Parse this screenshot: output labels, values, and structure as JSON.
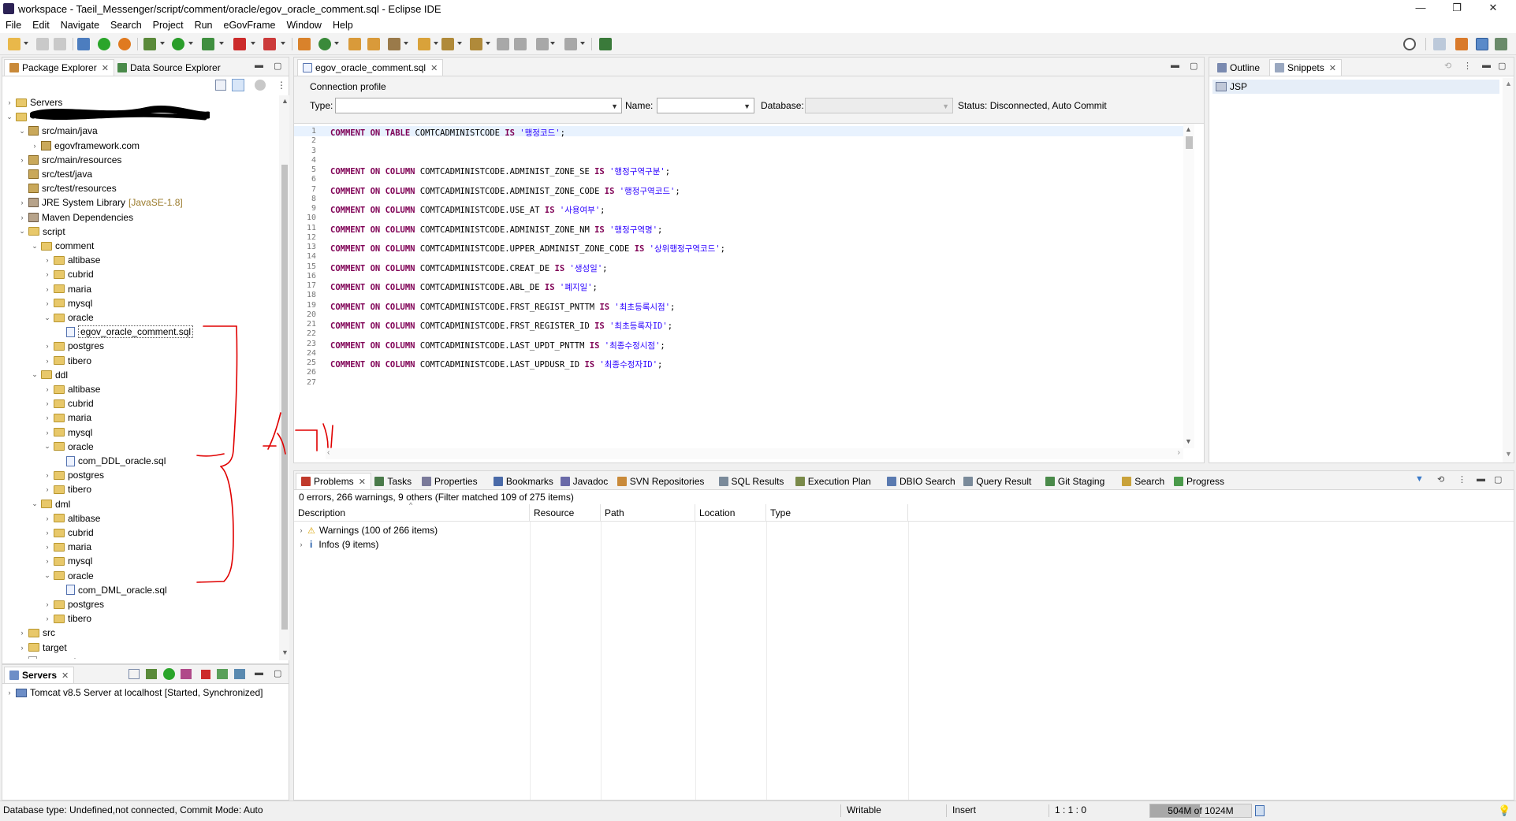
{
  "window": {
    "title": "workspace - Taeil_Messenger/script/comment/oracle/egov_oracle_comment.sql - Eclipse IDE",
    "minimize": "—",
    "maximize": "❐",
    "close": "✕"
  },
  "menu": [
    "File",
    "Edit",
    "Navigate",
    "Search",
    "Project",
    "Run",
    "eGovFrame",
    "Window",
    "Help"
  ],
  "left_panel": {
    "tabs": [
      "Package Explorer",
      "Data Source Explorer"
    ],
    "tree": [
      {
        "label": "Servers",
        "depth": 0,
        "icon": "folder",
        "twisty": "collapsed"
      },
      {
        "label": "",
        "depth": 0,
        "icon": "project",
        "twisty": "expanded",
        "redacted": true
      },
      {
        "label": "src/main/java",
        "depth": 1,
        "icon": "package-folder",
        "twisty": "expanded"
      },
      {
        "label": "egovframework.com",
        "depth": 2,
        "icon": "package",
        "twisty": "collapsed"
      },
      {
        "label": "src/main/resources",
        "depth": 1,
        "icon": "package-folder",
        "twisty": "collapsed"
      },
      {
        "label": "src/test/java",
        "depth": 1,
        "icon": "package-folder",
        "twisty": "none"
      },
      {
        "label": "src/test/resources",
        "depth": 1,
        "icon": "package-folder",
        "twisty": "none"
      },
      {
        "label": "JRE System Library",
        "suffix": "[JavaSE-1.8]",
        "depth": 1,
        "icon": "library",
        "twisty": "collapsed"
      },
      {
        "label": "Maven Dependencies",
        "depth": 1,
        "icon": "library",
        "twisty": "collapsed"
      },
      {
        "label": "script",
        "depth": 1,
        "icon": "folder",
        "twisty": "expanded"
      },
      {
        "label": "comment",
        "depth": 2,
        "icon": "folder",
        "twisty": "expanded"
      },
      {
        "label": "altibase",
        "depth": 3,
        "icon": "folder",
        "twisty": "collapsed"
      },
      {
        "label": "cubrid",
        "depth": 3,
        "icon": "folder",
        "twisty": "collapsed"
      },
      {
        "label": "maria",
        "depth": 3,
        "icon": "folder",
        "twisty": "collapsed"
      },
      {
        "label": "mysql",
        "depth": 3,
        "icon": "folder",
        "twisty": "collapsed"
      },
      {
        "label": "oracle",
        "depth": 3,
        "icon": "folder",
        "twisty": "expanded"
      },
      {
        "label": "egov_oracle_comment.sql",
        "depth": 4,
        "icon": "sql-file",
        "twisty": "none",
        "selected": true
      },
      {
        "label": "postgres",
        "depth": 3,
        "icon": "folder",
        "twisty": "collapsed"
      },
      {
        "label": "tibero",
        "depth": 3,
        "icon": "folder",
        "twisty": "collapsed"
      },
      {
        "label": "ddl",
        "depth": 2,
        "icon": "folder",
        "twisty": "expanded"
      },
      {
        "label": "altibase",
        "depth": 3,
        "icon": "folder",
        "twisty": "collapsed"
      },
      {
        "label": "cubrid",
        "depth": 3,
        "icon": "folder",
        "twisty": "collapsed"
      },
      {
        "label": "maria",
        "depth": 3,
        "icon": "folder",
        "twisty": "collapsed"
      },
      {
        "label": "mysql",
        "depth": 3,
        "icon": "folder",
        "twisty": "collapsed"
      },
      {
        "label": "oracle",
        "depth": 3,
        "icon": "folder",
        "twisty": "expanded"
      },
      {
        "label": "com_DDL_oracle.sql",
        "depth": 4,
        "icon": "sql-file",
        "twisty": "none"
      },
      {
        "label": "postgres",
        "depth": 3,
        "icon": "folder",
        "twisty": "collapsed"
      },
      {
        "label": "tibero",
        "depth": 3,
        "icon": "folder",
        "twisty": "collapsed"
      },
      {
        "label": "dml",
        "depth": 2,
        "icon": "folder",
        "twisty": "expanded"
      },
      {
        "label": "altibase",
        "depth": 3,
        "icon": "folder",
        "twisty": "collapsed"
      },
      {
        "label": "cubrid",
        "depth": 3,
        "icon": "folder",
        "twisty": "collapsed"
      },
      {
        "label": "maria",
        "depth": 3,
        "icon": "folder",
        "twisty": "collapsed"
      },
      {
        "label": "mysql",
        "depth": 3,
        "icon": "folder",
        "twisty": "collapsed"
      },
      {
        "label": "oracle",
        "depth": 3,
        "icon": "folder",
        "twisty": "expanded"
      },
      {
        "label": "com_DML_oracle.sql",
        "depth": 4,
        "icon": "sql-file",
        "twisty": "none"
      },
      {
        "label": "postgres",
        "depth": 3,
        "icon": "folder",
        "twisty": "collapsed"
      },
      {
        "label": "tibero",
        "depth": 3,
        "icon": "folder",
        "twisty": "collapsed"
      },
      {
        "label": "src",
        "depth": 1,
        "icon": "folder",
        "twisty": "collapsed"
      },
      {
        "label": "target",
        "depth": 1,
        "icon": "folder",
        "twisty": "collapsed"
      },
      {
        "label": "pom.xml",
        "depth": 1,
        "icon": "xml-file",
        "twisty": "none"
      }
    ]
  },
  "servers_panel": {
    "tab": "Servers",
    "items": [
      {
        "label": "Tomcat v8.5 Server at localhost  [Started, Synchronized]"
      }
    ]
  },
  "editor": {
    "tab": "egov_oracle_comment.sql",
    "connection_profile": {
      "label": "Connection profile",
      "type_label": "Type:",
      "type_value": "",
      "name_label": "Name:",
      "name_value": "",
      "database_label": "Database:",
      "database_value": "",
      "status": "Status: Disconnected, Auto Commit"
    },
    "lines": [
      {
        "n": "1",
        "col": "COMTCADMINISTCODE",
        "kind": "table",
        "comment": "'행정코드'"
      },
      {
        "n": "2"
      },
      {
        "n": "3"
      },
      {
        "n": "4"
      },
      {
        "n": "5",
        "col": "COMTCADMINISTCODE.ADMINIST_ZONE_SE",
        "kind": "column",
        "comment": "'행정구역구분'"
      },
      {
        "n": "6"
      },
      {
        "n": "7",
        "col": "COMTCADMINISTCODE.ADMINIST_ZONE_CODE",
        "kind": "column",
        "comment": "'행정구역코드'"
      },
      {
        "n": "8"
      },
      {
        "n": "9",
        "col": "COMTCADMINISTCODE.USE_AT",
        "kind": "column",
        "comment": "'사용여부'"
      },
      {
        "n": "10"
      },
      {
        "n": "11",
        "col": "COMTCADMINISTCODE.ADMINIST_ZONE_NM",
        "kind": "column",
        "comment": "'행정구역명'"
      },
      {
        "n": "12"
      },
      {
        "n": "13",
        "col": "COMTCADMINISTCODE.UPPER_ADMINIST_ZONE_CODE",
        "kind": "column",
        "comment": "'상위행정구역코드'"
      },
      {
        "n": "14"
      },
      {
        "n": "15",
        "col": "COMTCADMINISTCODE.CREAT_DE",
        "kind": "column",
        "comment": "'생성일'"
      },
      {
        "n": "16"
      },
      {
        "n": "17",
        "col": "COMTCADMINISTCODE.ABL_DE",
        "kind": "column",
        "comment": "'폐지일'"
      },
      {
        "n": "18"
      },
      {
        "n": "19",
        "col": "COMTCADMINISTCODE.FRST_REGIST_PNTTM",
        "kind": "column",
        "comment": "'최초등록시점'"
      },
      {
        "n": "20"
      },
      {
        "n": "21",
        "col": "COMTCADMINISTCODE.FRST_REGISTER_ID",
        "kind": "column",
        "comment": "'최초등록자ID'"
      },
      {
        "n": "22"
      },
      {
        "n": "23",
        "col": "COMTCADMINISTCODE.LAST_UPDT_PNTTM",
        "kind": "column",
        "comment": "'최종수정시점'"
      },
      {
        "n": "24"
      },
      {
        "n": "25",
        "col": "COMTCADMINISTCODE.LAST_UPDUSR_ID",
        "kind": "column",
        "comment": "'최종수정자ID'"
      },
      {
        "n": "26"
      },
      {
        "n": "27"
      }
    ],
    "keywords": {
      "comment": "COMMENT",
      "on": "ON",
      "table": "TABLE",
      "column": "COLUMN",
      "is": "IS",
      "end": ";"
    }
  },
  "right_panel": {
    "tabs": [
      "Outline",
      "Snippets"
    ],
    "items": [
      "JSP"
    ]
  },
  "bottom_panel": {
    "tabs": [
      "Problems",
      "Tasks",
      "Properties",
      "Bookmarks",
      "Javadoc",
      "SVN Repositories",
      "SQL Results",
      "Execution Plan",
      "DBIO Search",
      "Query Result",
      "Git Staging",
      "Search",
      "Progress"
    ],
    "summary": "0 errors, 266 warnings, 9 others (Filter matched 109 of 275 items)",
    "columns": [
      "Description",
      "Resource",
      "Path",
      "Location",
      "Type"
    ],
    "rows": [
      {
        "label": "Warnings (100 of 266 items)",
        "kind": "warning"
      },
      {
        "label": "Infos (9 items)",
        "kind": "info"
      }
    ]
  },
  "statusbar": {
    "db_status": "Database type: Undefined,not connected, Commit Mode: Auto",
    "writable": "Writable",
    "insert": "Insert",
    "position": "1 : 1 : 0",
    "heap": "504M of 1024M",
    "heap_fraction": 0.49
  },
  "colors": {
    "keyword": "#7f0055",
    "string": "#2a00ff",
    "annotation_red": "#e00000"
  }
}
